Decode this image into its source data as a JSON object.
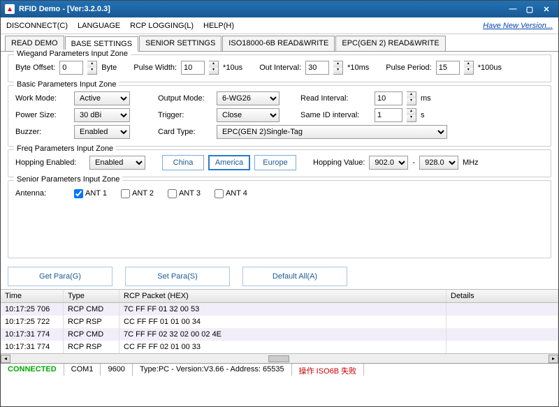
{
  "title": "RFID Demo - [Ver:3.2.0.3]",
  "version_link": "Have New Version...",
  "menu": {
    "disconnect": "DISCONNECT(C)",
    "language": "LANGUAGE",
    "rcp": "RCP LOGGING(L)",
    "help": "HELP(H)"
  },
  "tabs": [
    "READ DEMO",
    "BASE SETTINGS",
    "SENIOR SETTINGS",
    "ISO18000-6B READ&WRITE",
    "EPC(GEN 2) READ&WRITE"
  ],
  "groups": {
    "wiegand": {
      "title": "Wiegand Parameters Input Zone",
      "byte_offset_lbl": "Byte Offset:",
      "byte_offset": "0",
      "byte_unit": "Byte",
      "pulse_width_lbl": "Pulse Width:",
      "pulse_width": "10",
      "pw_unit": "*10us",
      "out_interval_lbl": "Out Interval:",
      "out_interval": "30",
      "oi_unit": "*10ms",
      "pulse_period_lbl": "Pulse Period:",
      "pulse_period": "15",
      "pp_unit": "*100us"
    },
    "basic": {
      "title": "Basic Parameters Input Zone",
      "work_mode_lbl": "Work Mode:",
      "work_mode": "Active",
      "output_mode_lbl": "Output Mode:",
      "output_mode": "6-WG26",
      "read_interval_lbl": "Read Interval:",
      "read_interval": "10",
      "ri_unit": "ms",
      "power_lbl": "Power Size:",
      "power": "30 dBi",
      "trigger_lbl": "Trigger:",
      "trigger": "Close",
      "sameid_lbl": "Same ID interval:",
      "sameid": "1",
      "sameid_unit": "s",
      "buzzer_lbl": "Buzzer:",
      "buzzer": "Enabled",
      "cardtype_lbl": "Card Type:",
      "cardtype": "EPC(GEN 2)Single-Tag"
    },
    "freq": {
      "title": "Freq Parameters Input Zone",
      "hopping_lbl": "Hopping Enabled:",
      "hopping": "Enabled",
      "regions": {
        "china": "China",
        "america": "America",
        "europe": "Europe"
      },
      "hv_lbl": "Hopping Value:",
      "hv_lo": "902.0",
      "hv_hi": "928.0",
      "hv_unit": "MHz",
      "sep": "-"
    },
    "senior": {
      "title": "Senior Parameters Input Zone",
      "antenna_lbl": "Antenna:",
      "ant1": "ANT 1",
      "ant2": "ANT 2",
      "ant3": "ANT 3",
      "ant4": "ANT 4"
    }
  },
  "actions": {
    "get": "Get Para(G)",
    "set": "Set Para(S)",
    "def": "Default All(A)"
  },
  "grid": {
    "headers": {
      "time": "Time",
      "type": "Type",
      "pkt": "RCP Packet (HEX)",
      "det": "Details"
    },
    "rows": [
      {
        "time": "10:17:25 706",
        "type": "RCP CMD",
        "pkt": "7C FF FF 01 32 00 53",
        "det": ""
      },
      {
        "time": "10:17:25 722",
        "type": "RCP RSP",
        "pkt": "CC FF FF 01 01 00 34",
        "det": ""
      },
      {
        "time": "10:17:31 774",
        "type": "RCP CMD",
        "pkt": "7C FF FF 02 32 02 00 02 4E",
        "det": ""
      },
      {
        "time": "10:17:31 774",
        "type": "RCP RSP",
        "pkt": "CC FF FF 02 01 00 33",
        "det": ""
      }
    ]
  },
  "status": {
    "conn": "CONNECTED",
    "port": "COM1",
    "baud": "9600",
    "ver": "Type:PC - Version:V3.66 - Address: 65535",
    "err": "操作 ISO6B 失败"
  }
}
